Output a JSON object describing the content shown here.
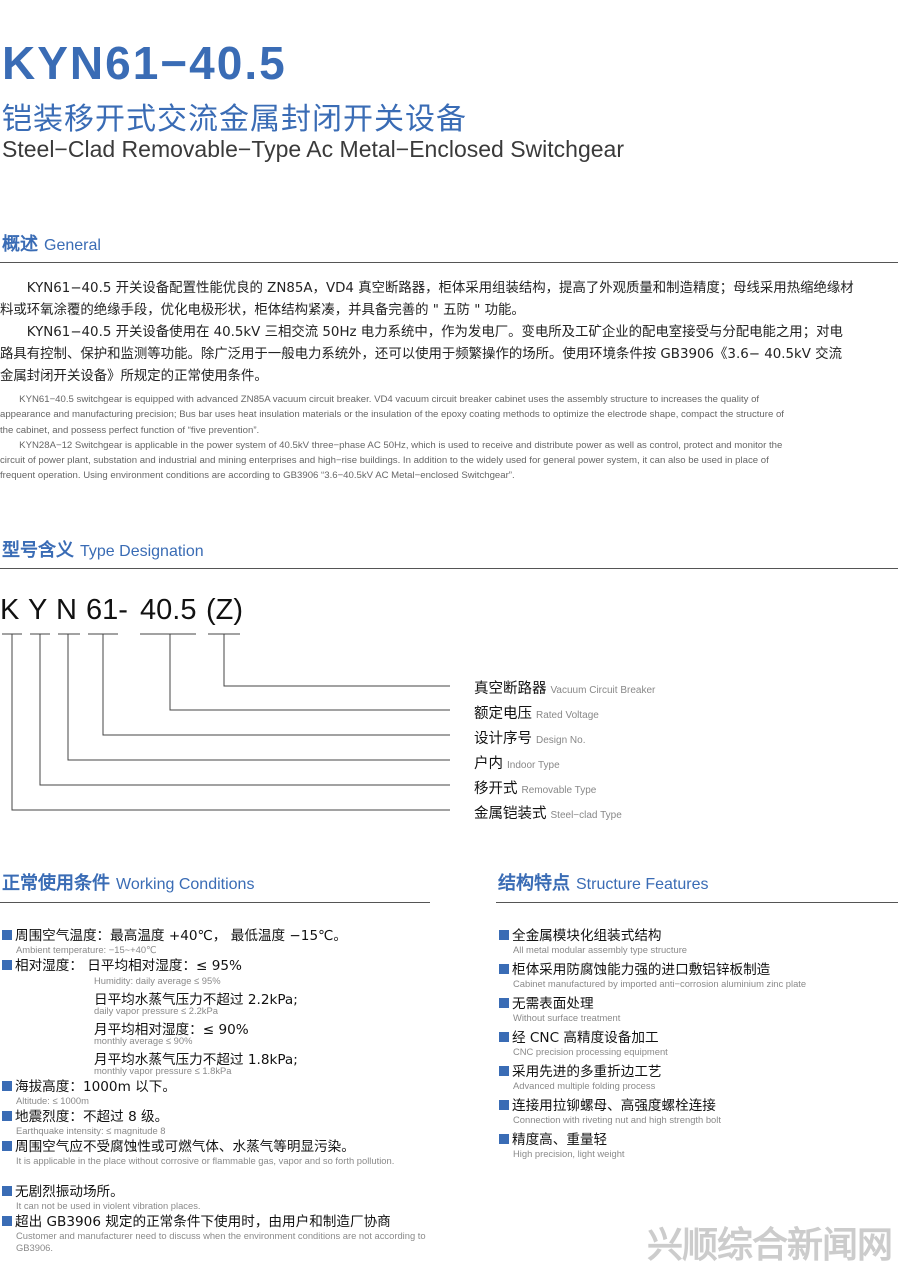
{
  "header": {
    "model": "KYN61−40.5",
    "title_cn": "铠装移开式交流金属封闭开关设备",
    "title_en": "Steel−Clad Removable−Type Ac Metal−Enclosed Switchgear"
  },
  "general": {
    "heading_cn": "概述",
    "heading_en": "General",
    "cn_p1_l1": "　　KYN61−40.5 开关设备配置性能优良的 ZN85A，VD4 真空断路器，柜体采用组装结构，提高了外观质量和制造精度；母线采用热缩绝缘材",
    "cn_p1_l2": "料或环氧涂覆的绝缘手段，优化电极形状，柜体结构紧凑，并具备完善的 \" 五防 \" 功能。",
    "cn_p2_l1": "　　KYN61−40.5 开关设备使用在 40.5kV 三相交流 50Hz 电力系统中，作为发电厂。变电所及工矿企业的配电室接受与分配电能之用；对电",
    "cn_p2_l2": "路具有控制、保护和监测等功能。除广泛用于一般电力系统外，还可以使用于频繁操作的场所。使用环境条件按 GB3906《3.6− 40.5kV 交流",
    "cn_p2_l3": "金属封闭开关设备》所规定的正常使用条件。",
    "en_l1": "　　KYN61−40.5 switchgear is equipped with advanced ZN85A vacuum circuit breaker. VD4 vacuum circuit breaker cabinet uses the assembly structure to increases the quality of",
    "en_l2": "appearance and manufacturing precision; Bus bar uses heat insulation materials or the insulation of the epoxy coating methods to optimize the electrode shape, compact the structure of",
    "en_l3": "the cabinet, and possess perfect function of  “five prevention”.",
    "en_l4": "　　KYN28A−12 Switchgear is applicable in the power system of 40.5kV three−phase AC 50Hz, which is used to receive and distribute power as well as control, protect and monitor the",
    "en_l5": "circuit of power plant, substation and industrial and mining enterprises and high−rise buildings. In addition to the widely used for general power system, it can also be used in place of",
    "en_l6": "frequent operation. Using environment conditions are according to GB3906  “3.6−40.5kV AC Metal−enclosed Switchgear”."
  },
  "type_designation": {
    "heading_cn": "型号含义",
    "heading_en": "Type Designation",
    "code": {
      "k": "K",
      "y": "Y",
      "n": "N",
      "num": "61-",
      "volt": "40.5",
      "z": "(Z)"
    },
    "labels": [
      {
        "cn": "真空断路器",
        "en": "Vacuum Circuit Breaker"
      },
      {
        "cn": "额定电压",
        "en": "Rated  Voltage"
      },
      {
        "cn": "设计序号",
        "en": "Design No."
      },
      {
        "cn": "户内",
        "en": "Indoor Type"
      },
      {
        "cn": "移开式",
        "en": "Removable Type"
      },
      {
        "cn": "金属铠装式",
        "en": "Steel−clad Type"
      }
    ]
  },
  "working_conditions": {
    "heading_cn": "正常使用条件",
    "heading_en": "Working Conditions",
    "temp_cn": "周围空气温度：最高温度 +40℃， 最低温度 −15℃。",
    "temp_en": "Ambient temperature: −15~+40℃",
    "hum_cn": "相对湿度： 日平均相对湿度：≤ 95%",
    "hum_en": "Humidity: daily average ≤ 95%",
    "vap_day_cn": "日平均水蒸气压力不超过 2.2kPa;",
    "vap_day_en": "daily vapor pressure ≤ 2.2kPa",
    "hum_month_cn": "月平均相对湿度：≤ 90%",
    "hum_month_en": "monthly average ≤ 90%",
    "vap_month_cn": "月平均水蒸气压力不超过 1.8kPa;",
    "vap_month_en": "monthly vapor pressure ≤ 1.8kPa",
    "alt_cn": "海拔高度：1000m 以下。",
    "alt_en": "Altitude: ≤ 1000m",
    "eq_cn": "地震烈度：不超过 8 级。",
    "eq_en": "Earthquake intensity: ≤ magnitude 8",
    "air_cn": "周围空气应不受腐蚀性或可燃气体、水蒸气等明显污染。",
    "air_en": "It is applicable in the place without corrosive or flammable gas, vapor and so forth pollution.",
    "vib_cn": "无剧烈振动场所。",
    "vib_en": "It can not be used in violent vibration places.",
    "beyond_cn": "超出 GB3906 规定的正常条件下使用时，由用户和制造厂协商",
    "beyond_en": "Customer and manufacturer need to discuss when the environment conditions are not according to GB3906."
  },
  "structure_features": {
    "heading_cn": "结构特点",
    "heading_en": "Structure Features",
    "items": [
      {
        "cn": "全金属模块化组装式结构",
        "en": "All metal modular assembly type structure"
      },
      {
        "cn": "柜体采用防腐蚀能力强的进口敷铝锌板制造",
        "en": "Cabinet manufactured by imported anti−corrosion aluminium zinc plate"
      },
      {
        "cn": "无需表面处理",
        "en": "Without surface treatment"
      },
      {
        "cn": "经 CNC 高精度设备加工",
        "en": "CNC precision processing equipment"
      },
      {
        "cn": "采用先进的多重折边工艺",
        "en": "Advanced multiple folding process"
      },
      {
        "cn": "连接用拉铆螺母、高强度螺栓连接",
        "en": "Connection with riveting nut and high strength bolt"
      },
      {
        "cn": "精度高、重量轻",
        "en": "High precision, light weight"
      }
    ]
  },
  "watermark": "兴顺综合新闻网"
}
